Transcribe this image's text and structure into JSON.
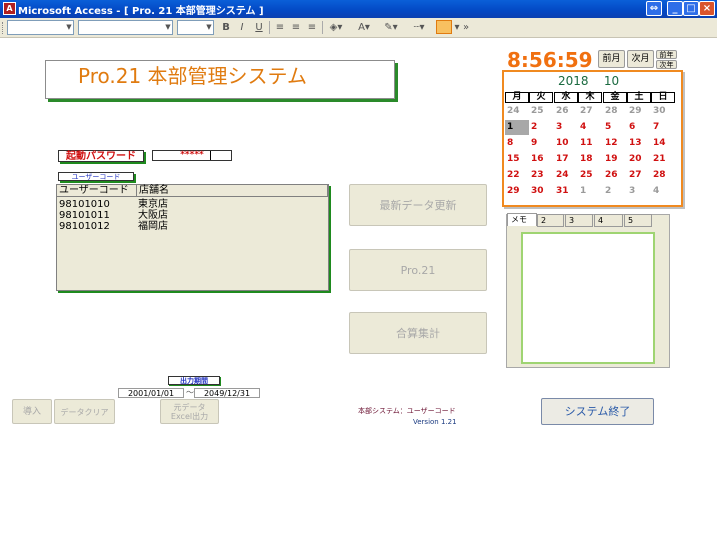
{
  "window": {
    "title": "Microsoft Access - [ Pro. 21  本部管理システム ]",
    "app_icon": "access-icon",
    "controls": {
      "restore": "⇔",
      "minimize": "_",
      "maximize": "□",
      "close": "×"
    }
  },
  "toolbar": {
    "bold": "B",
    "italic": "I",
    "underline": "U",
    "font_color": "A",
    "fill": "▾",
    "line": "▭"
  },
  "header": {
    "title": "Pro.21  本部管理システム"
  },
  "clock": {
    "time": "8:56:59"
  },
  "nav": {
    "prev_month": "前月",
    "next_month": "次月",
    "prev_year": "前年",
    "next_year": "次年"
  },
  "calendar": {
    "year": "2018",
    "month": "10",
    "dow": [
      "月",
      "火",
      "水",
      "木",
      "金",
      "土",
      "日"
    ],
    "dow_colors": [
      "#000000",
      "#000000",
      "#000000",
      "#000000",
      "#000000",
      "#000000",
      "#000000"
    ],
    "weeks": [
      [
        "24",
        "25",
        "26",
        "27",
        "28",
        "29",
        "30"
      ],
      [
        "1",
        "2",
        "3",
        "4",
        "5",
        "6",
        "7"
      ],
      [
        "8",
        "9",
        "10",
        "11",
        "12",
        "13",
        "14"
      ],
      [
        "15",
        "16",
        "17",
        "18",
        "19",
        "20",
        "21"
      ],
      [
        "22",
        "23",
        "24",
        "25",
        "26",
        "27",
        "28"
      ],
      [
        "29",
        "30",
        "31",
        "1",
        "2",
        "3",
        "4"
      ]
    ],
    "today": "1"
  },
  "password": {
    "label": "起動パスワード",
    "value": "*****"
  },
  "user_code": {
    "label": "ユーザーコード",
    "columns": [
      "ユーザーコード",
      "店舗名"
    ],
    "rows": [
      [
        "98101010",
        "東京店"
      ],
      [
        "98101011",
        "大阪店"
      ],
      [
        "98101012",
        "福岡店"
      ]
    ]
  },
  "actions": {
    "refresh": "最新データ更新",
    "pro21": "Pro.21",
    "total": "合算集計"
  },
  "memo": {
    "tabs": [
      "メモ",
      "2",
      "3",
      "4",
      "5"
    ]
  },
  "output": {
    "label": "出力期間",
    "from": "2001/01/01",
    "to": "2049/12/31",
    "import": "導入",
    "clear": "データクリア",
    "export_line1": "元データ",
    "export_line2": "Excel出力"
  },
  "exit": "システム終了",
  "footer": {
    "line1": "本部システム：ユーザーコード",
    "line2": "Version  1.21"
  }
}
